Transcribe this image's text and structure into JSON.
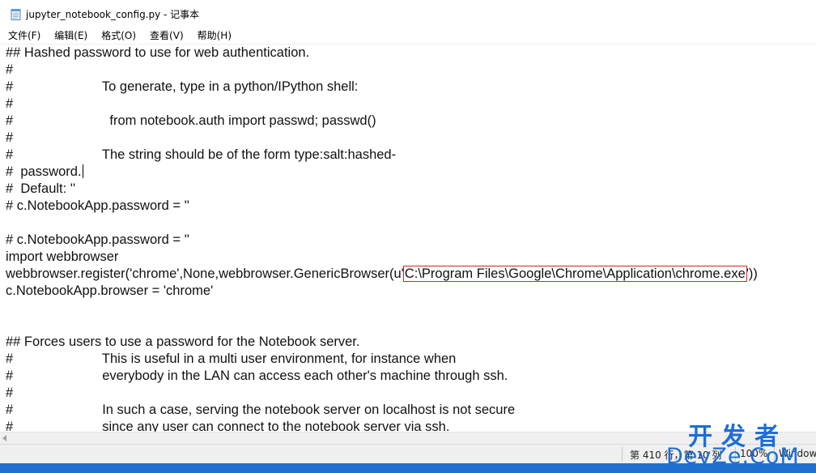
{
  "window": {
    "title": "jupyter_notebook_config.py - 记事本",
    "icon": "notepad-icon"
  },
  "menubar": {
    "items": [
      {
        "label": "文件(F)"
      },
      {
        "label": "编辑(E)"
      },
      {
        "label": "格式(O)"
      },
      {
        "label": "查看(V)"
      },
      {
        "label": "帮助(H)"
      }
    ]
  },
  "editor": {
    "lines": [
      "## Hashed password to use for web authentication.",
      "#",
      "#                        To generate, type in a python/IPython shell:",
      "#",
      "#                          from notebook.auth import passwd; passwd()",
      "#",
      "#                        The string should be of the form type:salt:hashed-",
      "#  password.",
      "#  Default: ''",
      "# c.NotebookApp.password = ''",
      "",
      "# c.NotebookApp.password = ''",
      "import webbrowser",
      "webbrowser.register('chrome',None,webbrowser.GenericBrowser(u'",
      "c.NotebookApp.browser = 'chrome'",
      "",
      "",
      "## Forces users to use a password for the Notebook server.",
      "#                        This is useful in a multi user environment, for instance when",
      "#                        everybody in the LAN can access each other's machine through ssh.",
      "#",
      "#                        In such a case, serving the notebook server on localhost is not secure",
      "#                        since any user can connect to the notebook server via ssh."
    ],
    "highlighted_path": "C:\\Program Files\\Google\\Chrome\\Application\\chrome.exe",
    "register_suffix": "'))",
    "highlight_color": "#e02020"
  },
  "statusbar": {
    "position": "第 410 行，第 10 列",
    "zoom": "100%",
    "eol": "Windows (CRLF)"
  },
  "watermark": {
    "cn": "开发者",
    "en": "DevZe.CoM",
    "color": "#1c6fd6"
  }
}
